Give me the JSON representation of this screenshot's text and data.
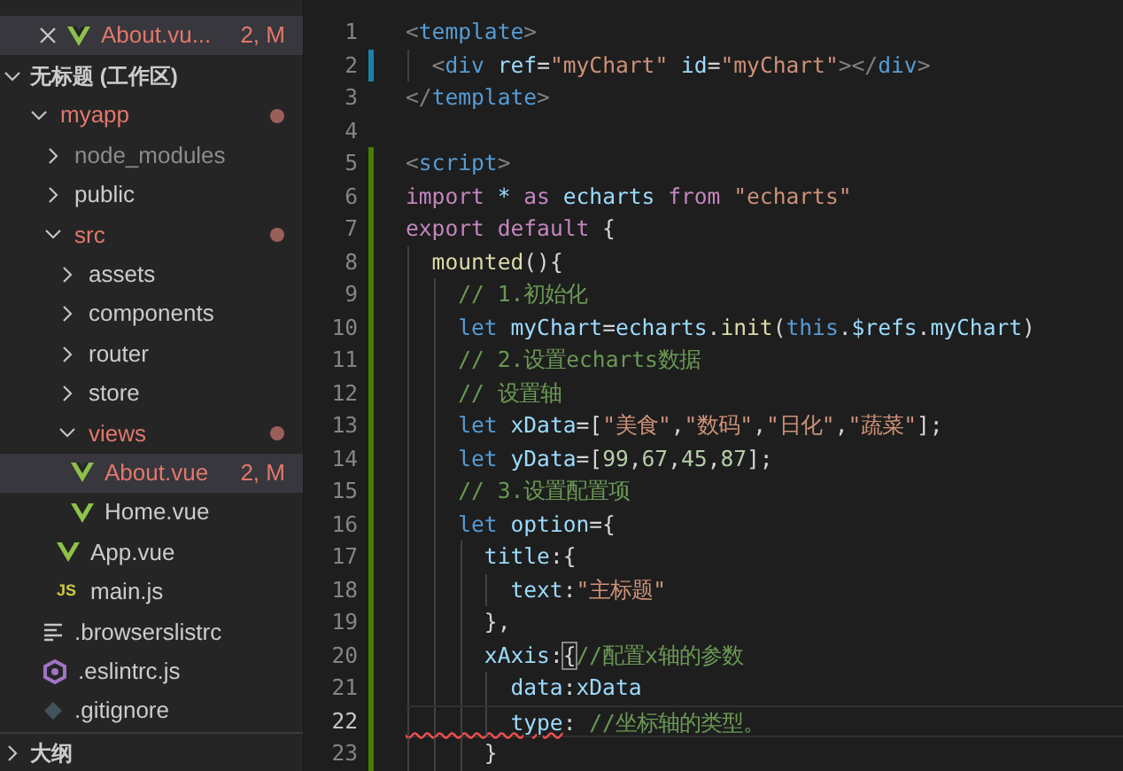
{
  "open_editors": [
    {
      "label": "About.vu...",
      "badge": "2, M",
      "kind": "vue",
      "modified": true,
      "selected": true
    }
  ],
  "workspace": {
    "label": "无标题 (工作区)",
    "expanded": true,
    "tree": [
      {
        "label": "myapp",
        "kind": "folder",
        "expanded": true,
        "modified": true,
        "children": [
          {
            "label": "node_modules",
            "kind": "folder",
            "expanded": false,
            "ignored": true
          },
          {
            "label": "public",
            "kind": "folder",
            "expanded": false
          },
          {
            "label": "src",
            "kind": "folder",
            "expanded": true,
            "modified": true,
            "children": [
              {
                "label": "assets",
                "kind": "folder",
                "expanded": false
              },
              {
                "label": "components",
                "kind": "folder",
                "expanded": false
              },
              {
                "label": "router",
                "kind": "folder",
                "expanded": false
              },
              {
                "label": "store",
                "kind": "folder",
                "expanded": false
              },
              {
                "label": "views",
                "kind": "folder",
                "expanded": true,
                "modified": true,
                "children": [
                  {
                    "label": "About.vue",
                    "kind": "vue",
                    "modified": true,
                    "badge": "2, M",
                    "selected": true
                  },
                  {
                    "label": "Home.vue",
                    "kind": "vue",
                    "selected": false
                  }
                ]
              },
              {
                "label": "App.vue",
                "kind": "vue",
                "selected": false
              },
              {
                "label": "main.js",
                "kind": "js",
                "icon_text": "JS",
                "selected": false
              }
            ]
          },
          {
            "label": ".browserslistrc",
            "kind": "config",
            "selected": false
          },
          {
            "label": ".eslintrc.js",
            "kind": "eslint",
            "selected": false
          },
          {
            "label": ".gitignore",
            "kind": "git",
            "selected": false
          }
        ]
      }
    ]
  },
  "outline": {
    "label": "大纲",
    "expanded": false
  },
  "editor": {
    "lines": [
      {
        "number": "1",
        "modified": false,
        "added": false,
        "current": false,
        "tokens": [
          {
            "kind": "punct",
            "text": "<"
          },
          {
            "kind": "tag",
            "text": "template"
          },
          {
            "kind": "punct",
            "text": ">"
          }
        ]
      },
      {
        "number": "2",
        "modified": true,
        "added": false,
        "current": false,
        "tokens": [
          {
            "kind": "punct",
            "text": "  <"
          },
          {
            "kind": "tag",
            "text": "div"
          },
          {
            "kind": "attr",
            "text": " ref"
          },
          {
            "kind": "plain",
            "text": "="
          },
          {
            "kind": "str",
            "text": "\"myChart\""
          },
          {
            "kind": "attr",
            "text": " id"
          },
          {
            "kind": "plain",
            "text": "="
          },
          {
            "kind": "str",
            "text": "\"myChart\""
          },
          {
            "kind": "punct",
            "text": "></"
          },
          {
            "kind": "tag",
            "text": "div"
          },
          {
            "kind": "punct",
            "text": ">"
          }
        ]
      },
      {
        "number": "3",
        "modified": false,
        "added": false,
        "current": false,
        "tokens": [
          {
            "kind": "punct",
            "text": "</"
          },
          {
            "kind": "tag",
            "text": "template"
          },
          {
            "kind": "punct",
            "text": ">"
          }
        ]
      },
      {
        "number": "4",
        "modified": false,
        "added": false,
        "current": false
      },
      {
        "number": "5",
        "modified": false,
        "added": true,
        "current": false,
        "tokens": [
          {
            "kind": "punct",
            "text": "<"
          },
          {
            "kind": "tag",
            "text": "script"
          },
          {
            "kind": "punct",
            "text": ">"
          }
        ]
      },
      {
        "number": "6",
        "modified": false,
        "added": true,
        "current": false,
        "tokens": [
          {
            "kind": "kw",
            "text": "import"
          },
          {
            "kind": "var",
            "text": " * "
          },
          {
            "kind": "kw",
            "text": "as"
          },
          {
            "kind": "var",
            "text": " echarts "
          },
          {
            "kind": "kw",
            "text": "from"
          },
          {
            "kind": "str",
            "text": " \"echarts\""
          }
        ]
      },
      {
        "number": "7",
        "modified": false,
        "added": true,
        "current": false,
        "tokens": [
          {
            "kind": "kw",
            "text": "export"
          },
          {
            "kind": "kw",
            "text": " default"
          },
          {
            "kind": "plain",
            "text": " {"
          }
        ]
      },
      {
        "number": "8",
        "modified": false,
        "added": true,
        "current": false,
        "tokens": [
          {
            "kind": "fn",
            "text": "  mounted"
          },
          {
            "kind": "plain",
            "text": "(){"
          }
        ]
      },
      {
        "number": "9",
        "modified": false,
        "added": true,
        "current": false,
        "tokens": [
          {
            "kind": "comment",
            "text": "    // 1.初始化"
          }
        ]
      },
      {
        "number": "10",
        "modified": false,
        "added": true,
        "current": false,
        "tokens": [
          {
            "kind": "let",
            "text": "    let"
          },
          {
            "kind": "var",
            "text": " myChart"
          },
          {
            "kind": "plain",
            "text": "="
          },
          {
            "kind": "var",
            "text": "echarts"
          },
          {
            "kind": "plain",
            "text": "."
          },
          {
            "kind": "fn",
            "text": "init"
          },
          {
            "kind": "plain",
            "text": "("
          },
          {
            "kind": "let",
            "text": "this"
          },
          {
            "kind": "plain",
            "text": "."
          },
          {
            "kind": "var",
            "text": "$refs"
          },
          {
            "kind": "plain",
            "text": "."
          },
          {
            "kind": "var",
            "text": "myChart"
          },
          {
            "kind": "plain",
            "text": ")"
          }
        ]
      },
      {
        "number": "11",
        "modified": false,
        "added": true,
        "current": false,
        "tokens": [
          {
            "kind": "comment",
            "text": "    // 2.设置echarts数据"
          }
        ]
      },
      {
        "number": "12",
        "modified": false,
        "added": true,
        "current": false,
        "tokens": [
          {
            "kind": "comment",
            "text": "    // 设置轴"
          }
        ]
      },
      {
        "number": "13",
        "modified": false,
        "added": true,
        "current": false,
        "tokens": [
          {
            "kind": "let",
            "text": "    let"
          },
          {
            "kind": "var",
            "text": " xData"
          },
          {
            "kind": "plain",
            "text": "=["
          },
          {
            "kind": "str",
            "text": "\"美食\""
          },
          {
            "kind": "plain",
            "text": ","
          },
          {
            "kind": "str",
            "text": "\"数码\""
          },
          {
            "kind": "plain",
            "text": ","
          },
          {
            "kind": "str",
            "text": "\"日化\""
          },
          {
            "kind": "plain",
            "text": ","
          },
          {
            "kind": "str",
            "text": "\"蔬菜\""
          },
          {
            "kind": "plain",
            "text": "];"
          }
        ]
      },
      {
        "number": "14",
        "modified": false,
        "added": true,
        "current": false,
        "tokens": [
          {
            "kind": "let",
            "text": "    let"
          },
          {
            "kind": "var",
            "text": " yData"
          },
          {
            "kind": "plain",
            "text": "=["
          },
          {
            "kind": "num",
            "text": "99"
          },
          {
            "kind": "plain",
            "text": ","
          },
          {
            "kind": "num",
            "text": "67"
          },
          {
            "kind": "plain",
            "text": ","
          },
          {
            "kind": "num",
            "text": "45"
          },
          {
            "kind": "plain",
            "text": ","
          },
          {
            "kind": "num",
            "text": "87"
          },
          {
            "kind": "plain",
            "text": "];"
          }
        ]
      },
      {
        "number": "15",
        "modified": false,
        "added": true,
        "current": false,
        "tokens": [
          {
            "kind": "comment",
            "text": "    // 3.设置配置项"
          }
        ]
      },
      {
        "number": "16",
        "modified": false,
        "added": true,
        "current": false,
        "tokens": [
          {
            "kind": "let",
            "text": "    let"
          },
          {
            "kind": "var",
            "text": " option"
          },
          {
            "kind": "plain",
            "text": "={"
          }
        ]
      },
      {
        "number": "17",
        "modified": false,
        "added": true,
        "current": false,
        "tokens": [
          {
            "kind": "var",
            "text": "      title"
          },
          {
            "kind": "plain",
            "text": ":{"
          }
        ]
      },
      {
        "number": "18",
        "modified": false,
        "added": true,
        "current": false,
        "tokens": [
          {
            "kind": "var",
            "text": "        text"
          },
          {
            "kind": "plain",
            "text": ":"
          },
          {
            "kind": "str",
            "text": "\"主标题\""
          }
        ]
      },
      {
        "number": "19",
        "modified": false,
        "added": true,
        "current": false,
        "tokens": [
          {
            "kind": "plain",
            "text": "      },"
          }
        ]
      },
      {
        "number": "20",
        "modified": false,
        "added": true,
        "current": false,
        "tokens": [
          {
            "kind": "var",
            "text": "      xAxis"
          },
          {
            "kind": "plain",
            "text": ":"
          },
          {
            "kind": "bracket",
            "text": "{"
          },
          {
            "kind": "comment",
            "text": "//配置x轴的参数"
          }
        ]
      },
      {
        "number": "21",
        "modified": false,
        "added": true,
        "current": false,
        "tokens": [
          {
            "kind": "var",
            "text": "        data"
          },
          {
            "kind": "plain",
            "text": ":"
          },
          {
            "kind": "var",
            "text": "xData"
          }
        ]
      },
      {
        "number": "22",
        "modified": false,
        "added": true,
        "current": true,
        "tokens": [
          {
            "kind": "error",
            "text": "        type"
          },
          {
            "kind": "plain",
            "text": ": "
          },
          {
            "kind": "comment",
            "text": "//坐标轴的类型。"
          }
        ]
      },
      {
        "number": "23",
        "modified": false,
        "added": true,
        "current": false,
        "tokens": [
          {
            "kind": "plain",
            "text": "      }"
          }
        ]
      }
    ]
  }
}
